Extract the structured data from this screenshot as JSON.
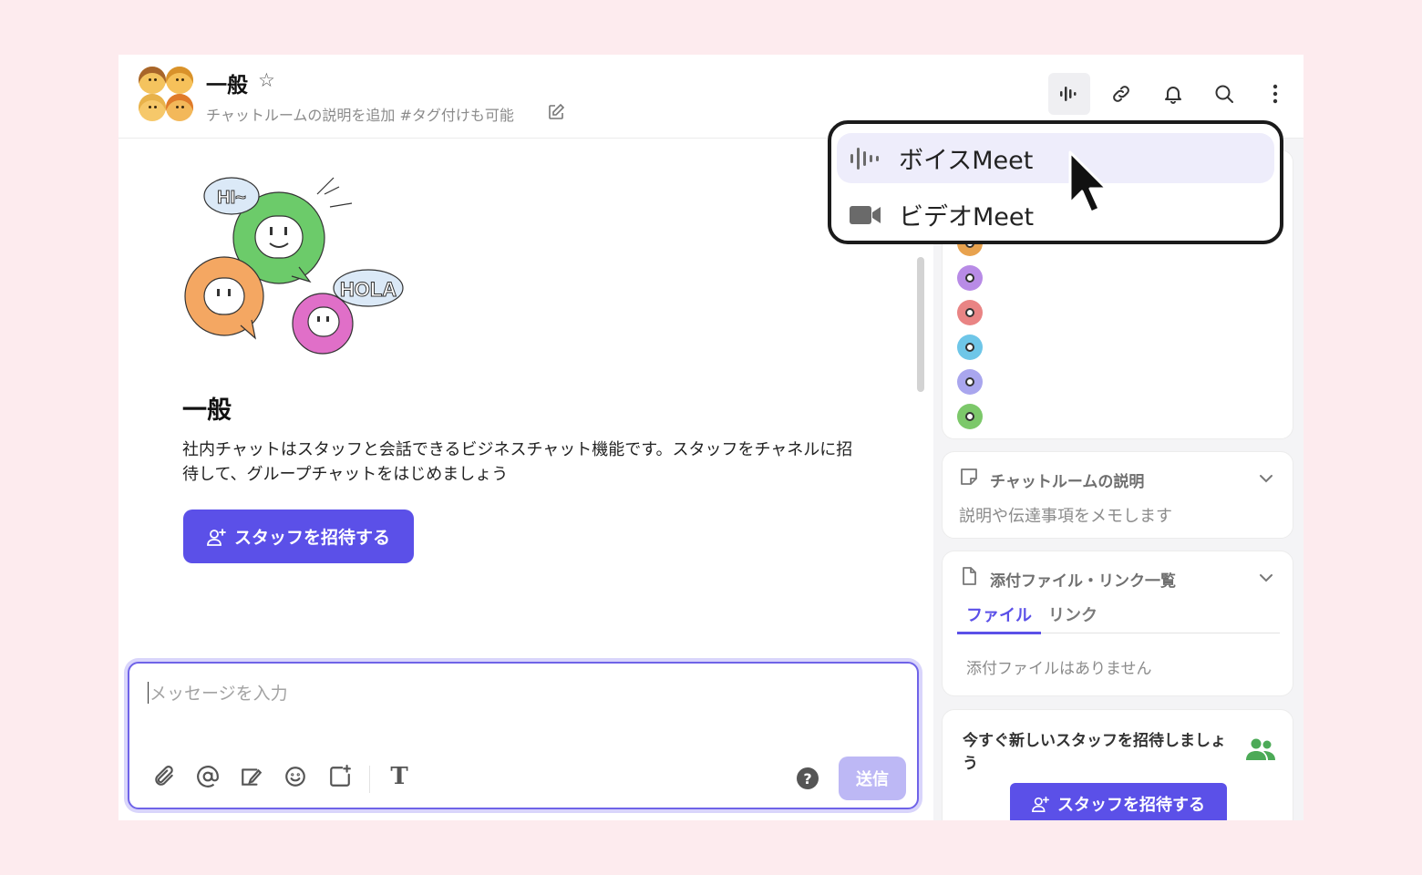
{
  "header": {
    "title": "一般",
    "description": "チャットルームの説明を追加 #タグ付けも可能"
  },
  "meet_menu": {
    "items": [
      {
        "label": "ボイスMeet",
        "icon": "voice-wave-icon"
      },
      {
        "label": "ビデオMeet",
        "icon": "video-camera-icon"
      }
    ]
  },
  "main": {
    "title": "一般",
    "description": "社内チャットはスタッフと会話できるビジネスチャット機能です。スタッフをチャネルに招待して、グループチャットをはじめましょう",
    "invite_label": "スタッフを招待する",
    "bubbles": {
      "hi": "HI~",
      "hola": "HOLA"
    }
  },
  "composer": {
    "placeholder": "メッセージを入力",
    "send_label": "送信",
    "help": "?",
    "text_tool": "T"
  },
  "panel_desc": {
    "title": "チャットルームの説明",
    "body": "説明や伝達事項をメモします"
  },
  "panel_files": {
    "title": "添付ファイル・リンク一覧",
    "tabs": [
      "ファイル",
      "リンク"
    ],
    "empty": "添付ファイルはありません"
  },
  "panel_invite": {
    "title": "今すぐ新しいスタッフを招待しましょう",
    "button": "スタッフを招待する"
  },
  "colors": {
    "accent": "#5b50e8",
    "background": "#fdebee",
    "menu_hover": "#eeedfb"
  }
}
